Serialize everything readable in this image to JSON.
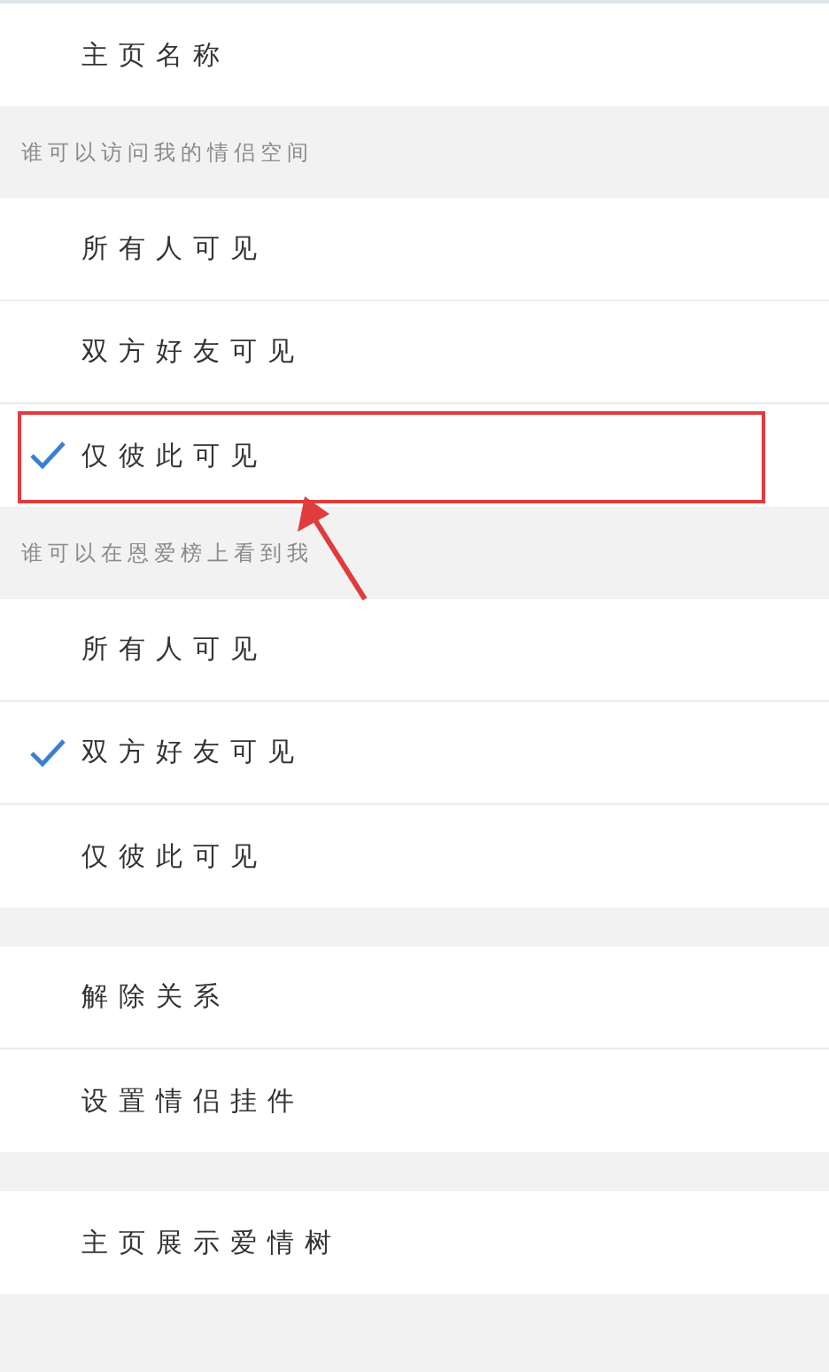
{
  "sections": [
    {
      "kind": "plain",
      "items": [
        {
          "label": "主页名称"
        }
      ]
    },
    {
      "kind": "choice",
      "header": "谁可以访问我的情侣空间",
      "items": [
        {
          "label": "所有人可见",
          "selected": false,
          "highlighted": false
        },
        {
          "label": "双方好友可见",
          "selected": false,
          "highlighted": false
        },
        {
          "label": "仅彼此可见",
          "selected": true,
          "highlighted": true
        }
      ]
    },
    {
      "kind": "choice",
      "header": "谁可以在恩爱榜上看到我",
      "items": [
        {
          "label": "所有人可见",
          "selected": false,
          "highlighted": false
        },
        {
          "label": "双方好友可见",
          "selected": true,
          "highlighted": false
        },
        {
          "label": "仅彼此可见",
          "selected": false,
          "highlighted": false
        }
      ]
    },
    {
      "kind": "plain",
      "items": [
        {
          "label": "解除关系"
        },
        {
          "label": "设置情侣挂件"
        }
      ]
    },
    {
      "kind": "plain",
      "items": [
        {
          "label": "主页展示爱情树"
        }
      ]
    }
  ]
}
